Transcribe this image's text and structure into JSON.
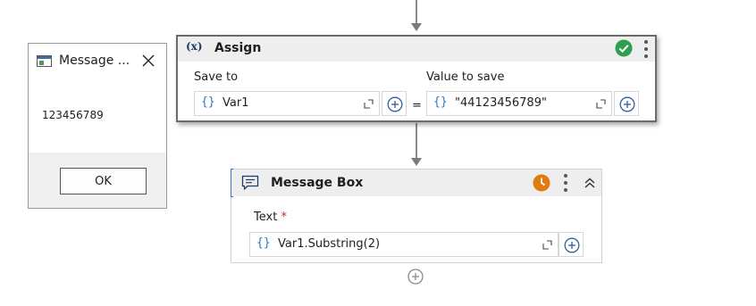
{
  "message_dialog": {
    "title": "Message ...",
    "content": "123456789",
    "ok_label": "OK"
  },
  "assign": {
    "title": "Assign",
    "save_to_label": "Save to",
    "save_to_value": "Var1",
    "equals": "=",
    "value_label": "Value to save",
    "value_value": "\"44123456789\""
  },
  "message_box": {
    "title": "Message Box",
    "text_label": "Text",
    "required_mark": "*",
    "text_value": "Var1.Substring(2)"
  },
  "icons": {
    "brace": "{}",
    "variable_icon_text": "(x)"
  },
  "colors": {
    "success_green": "#2e9e4f",
    "pending_orange": "#e07b12",
    "accent_blue": "#2b78c4"
  }
}
